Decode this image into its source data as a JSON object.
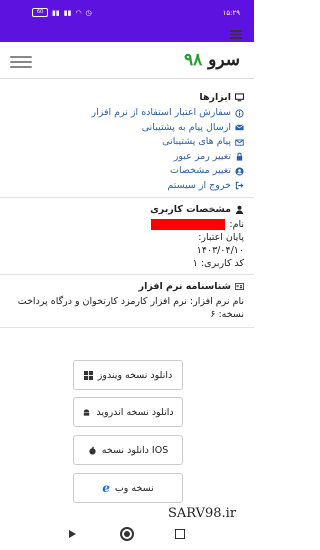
{
  "statusbar": {
    "time": "۱۵:۲۹",
    "battery": "60"
  },
  "app": {
    "logo_text": "سرو",
    "logo_num": "۹۸"
  },
  "tools": {
    "title": "ابزارها",
    "items": [
      {
        "label": "سفارش اعتبار استفاده از نرم افزار",
        "icon": "info-icon"
      },
      {
        "label": "ارسال پیام به پشتیبانی",
        "icon": "envelope-icon"
      },
      {
        "label": "پیام های پشتیبانی",
        "icon": "envelope-open-icon"
      },
      {
        "label": "تغییر رمز عبور",
        "icon": "lock-icon"
      },
      {
        "label": "تغییر مشخصات",
        "icon": "user-circle-icon"
      },
      {
        "label": "خروج از سیستم",
        "icon": "sign-out-icon"
      }
    ]
  },
  "user": {
    "title": "مشخصات کاربری",
    "name_label": "نام:",
    "expiry_label": "پایان اعتبار:",
    "expiry_value": "۱۴۰۳/۰۴/۱۰",
    "code_label": "کد کاربری:",
    "code_value": "۱"
  },
  "software": {
    "title": "شناسنامه نرم افزار",
    "name_line": "نام نرم افزار: نرم افزار کارمزد کارتخوان و درگاه پرداخت",
    "version_line": "نسخه: ۶"
  },
  "downloads": {
    "windows": "دانلود نسخه ویندوز",
    "android": "دانلود نسخه اندروید",
    "ios": "دانلود نسخه IOS",
    "web": "نسخه وب"
  },
  "watermark": "SARV98.ir"
}
